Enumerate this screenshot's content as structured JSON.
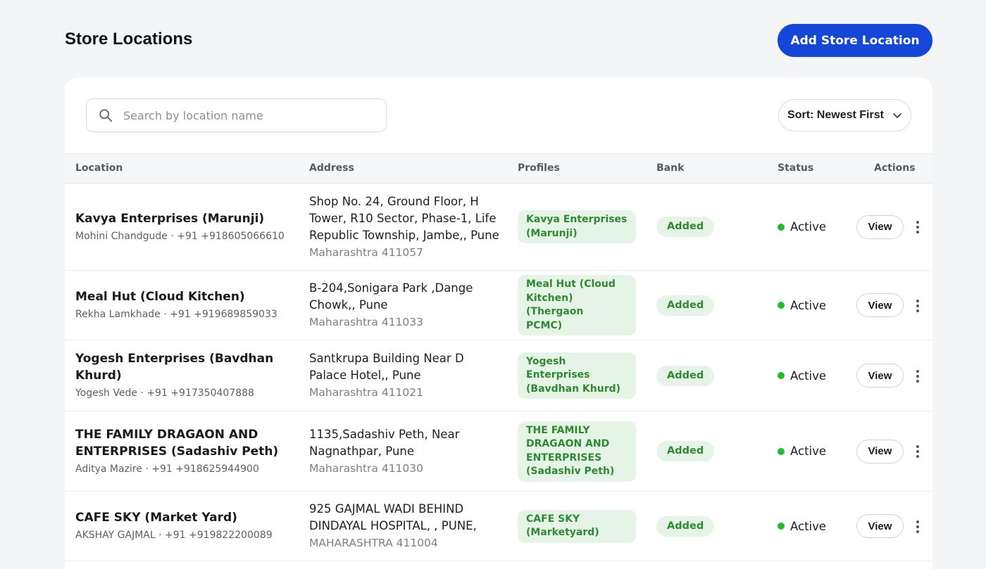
{
  "header": {
    "title": "Store Locations",
    "add_button_label": "Add Store Location"
  },
  "toolbar": {
    "search_placeholder": "Search by location name",
    "sort_label": "Sort: Newest First"
  },
  "table": {
    "columns": [
      "Location",
      "Address",
      "Profiles",
      "Bank",
      "Status",
      "Actions"
    ],
    "view_label": "View",
    "rows": [
      {
        "name_lines": [
          "Kavya Enterprises (Marunji)"
        ],
        "contact": "Mohini Chandgude · +91 +918605066610",
        "address_lines": [
          "Shop No. 24, Ground Floor, H",
          "Tower, R10 Sector, Phase-1, Life",
          "Republic Township, Jambe,, Pune"
        ],
        "address_state": "Maharashtra 411057",
        "profile_lines": [
          "Kavya Enterprises",
          "(Marunji)"
        ],
        "bank": "Added",
        "status": "Active"
      },
      {
        "name_lines": [
          "Meal Hut (Cloud Kitchen)"
        ],
        "contact": "Rekha Lamkhade · +91 +919689859033",
        "address_lines": [
          "B-204,Sonigara Park ,Dange",
          "Chowk,, Pune"
        ],
        "address_state": "Maharashtra 411033",
        "profile_lines": [
          "Meal Hut (Cloud",
          "Kitchen) (Thergaon",
          "PCMC)"
        ],
        "bank": "Added",
        "status": "Active"
      },
      {
        "name_lines": [
          "Yogesh Enterprises (Bavdhan",
          "Khurd)"
        ],
        "contact": "Yogesh Vede · +91 +917350407888",
        "address_lines": [
          "Santkrupa Building Near D",
          "Palace Hotel,, Pune"
        ],
        "address_state": "Maharashtra 411021",
        "profile_lines": [
          "Yogesh Enterprises",
          "(Bavdhan Khurd)"
        ],
        "bank": "Added",
        "status": "Active"
      },
      {
        "name_lines": [
          "THE FAMILY DRAGAON AND",
          "ENTERPRISES (Sadashiv Peth)"
        ],
        "contact": "Aditya Mazire · +91 +918625944900",
        "address_lines": [
          "1135,Sadashiv Peth, Near",
          "Nagnathpar, Pune"
        ],
        "address_state": "Maharashtra 411030",
        "profile_lines": [
          "THE FAMILY",
          "DRAGAON AND",
          "ENTERPRISES",
          "(Sadashiv Peth)"
        ],
        "bank": "Added",
        "status": "Active"
      },
      {
        "name_lines": [
          "CAFE SKY (Market Yard)"
        ],
        "contact": "AKSHAY GAJMAL · +91 +919822200089",
        "address_lines": [
          "925 GAJMAL WADI BEHIND",
          "DINDAYAL HOSPITAL, , PUNE,"
        ],
        "address_state": "MAHARASHTRA 411004",
        "profile_lines": [
          "CAFE SKY",
          "(Marketyard)"
        ],
        "bank": "Added",
        "status": "Active"
      }
    ]
  },
  "colors": {
    "primary": "#1447d8",
    "chip_bg": "#e6f4e7",
    "chip_text": "#2e8a32",
    "active_dot": "#1fbf2a"
  },
  "icons": {
    "search": "search-icon",
    "sort": "chevron-down-icon",
    "more": "more-vertical-icon"
  }
}
